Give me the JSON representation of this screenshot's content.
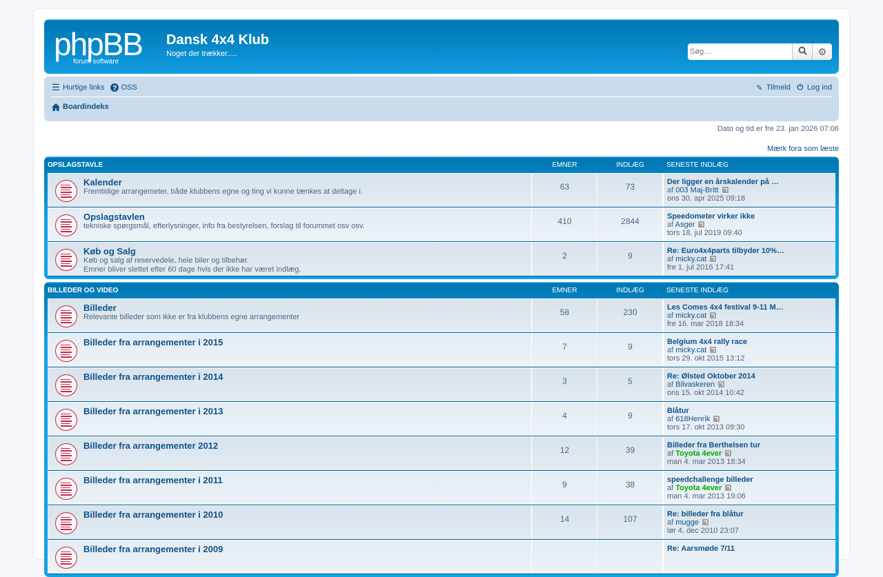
{
  "header": {
    "logo_text": "phpBB forum software",
    "site_title": "Dansk 4x4 Klub",
    "site_description": "Noget der trækker.....",
    "search_placeholder": "Søg…"
  },
  "nav": {
    "quick_links": "Hurtige links",
    "faq": "OSS",
    "register": "Tilmeld",
    "login": "Log ind",
    "breadcrumb": "Boardindeks"
  },
  "datetime": "Dato og tid er fre 23. jan 2026 07:06",
  "mark_read": "Mærk fora som læste",
  "categories": [
    {
      "title": "OPSLAGSTAVLE",
      "col_topics": "EMNER",
      "col_posts": "INDLÆG",
      "col_last": "SENESTE INDLÆG",
      "forums": [
        {
          "name": "Kalender",
          "desc": [
            "Fremtidige arrangemeter, både klubbens egne og ting vi kunne tænkes at deltage i."
          ],
          "topics": "63",
          "posts": "73",
          "last_title": "Der ligger en årskalender på …",
          "by": "af",
          "author": "003 Maj-Britt",
          "date": "ons 30. apr 2025 09:18"
        },
        {
          "name": "Opslagstavlen",
          "desc": [
            "tekniske spørgsmål, efterlysninger, info fra bestyrelsen, forslag til forummet osv osv."
          ],
          "topics": "410",
          "posts": "2844",
          "last_title": "Speedometer virker ikke",
          "by": "af",
          "author": "Asger",
          "date": "tors 18. jul 2019 09:40"
        },
        {
          "name": "Køb og Salg",
          "desc": [
            "Køb og salg af reservedele, hele biler og tilbehør.",
            "Emner bliver slettet efter 60 dage hvis der ikke har været indlæg."
          ],
          "topics": "2",
          "posts": "9",
          "last_title": "Re: Euro4x4parts tilbyder 10%…",
          "by": "af",
          "author": "micky.cat",
          "date": "fre 1. jul 2016 17:41"
        }
      ]
    },
    {
      "title": "BILLEDER OG VIDEO",
      "col_topics": "EMNER",
      "col_posts": "INDLÆG",
      "col_last": "SENESTE INDLÆG",
      "forums": [
        {
          "name": "Billeder",
          "desc": [
            "Relevante billeder som ikke er fra klubbens egne arrangementer"
          ],
          "topics": "58",
          "posts": "230",
          "last_title": "Les Comes 4x4 festival 9-11 M…",
          "by": "af",
          "author": "micky.cat",
          "date": "fre 16. mar 2018 18:34"
        },
        {
          "name": "Billeder fra arrangementer i 2015",
          "desc": [],
          "topics": "7",
          "posts": "9",
          "last_title": "Belgium 4x4 rally race",
          "by": "af",
          "author": "micky.cat",
          "date": "tors 29. okt 2015 13:12"
        },
        {
          "name": "Billeder fra arrangementer i 2014",
          "desc": [],
          "topics": "3",
          "posts": "5",
          "last_title": "Re: Ølsted Oktober 2014",
          "by": "af",
          "author": "Bilvaskeren",
          "date": "ons 15. okt 2014 10:42"
        },
        {
          "name": "Billeder fra arrangementer i 2013",
          "desc": [],
          "topics": "4",
          "posts": "9",
          "last_title": "Blåtur",
          "by": "af",
          "author": "618Henrik",
          "date": "tors 17. okt 2013 09:30"
        },
        {
          "name": "Billeder fra arrangementer 2012",
          "desc": [],
          "topics": "12",
          "posts": "39",
          "last_title": "Billeder fra Berthelsen tur",
          "by": "af",
          "author": "Toyota 4ever",
          "author_green": true,
          "date": "man 4. mar 2013 18:34"
        },
        {
          "name": "Billeder fra arrangementer i 2011",
          "desc": [],
          "topics": "9",
          "posts": "38",
          "last_title": "speedchallenge billeder",
          "by": "af",
          "author": "Toyota 4ever",
          "author_green": true,
          "date": "man 4. mar 2013 19:06"
        },
        {
          "name": "Billeder fra arrangementer i 2010",
          "desc": [],
          "topics": "14",
          "posts": "107",
          "last_title": "Re: billeder fra blåtur",
          "by": "af",
          "author": "mugge",
          "date": "lør 4. dec 2010 23:07"
        },
        {
          "name": "Billeder fra arrangementer i 2009",
          "desc": [],
          "topics": "",
          "posts": "",
          "last_title": "Re: Aarsmøde 7/11",
          "by": "",
          "author": "",
          "date": ""
        }
      ]
    }
  ]
}
